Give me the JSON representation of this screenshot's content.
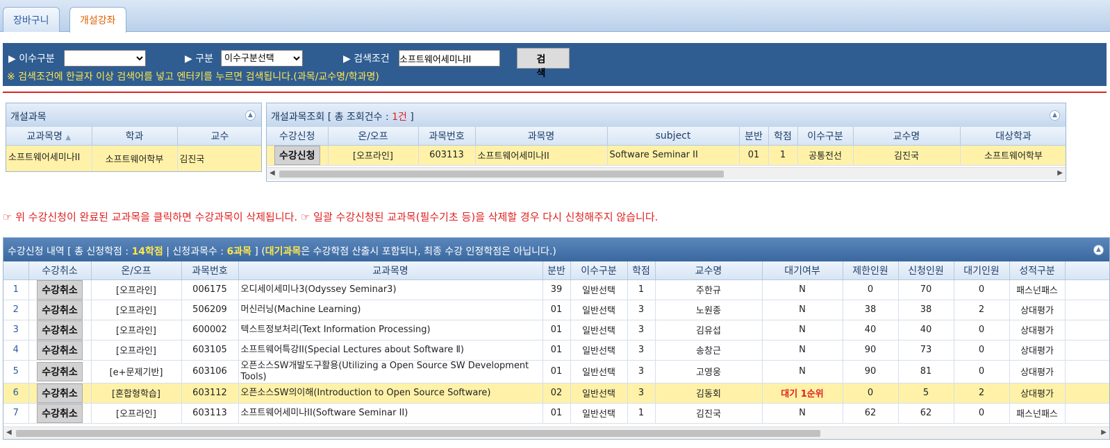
{
  "tabs": [
    {
      "label": "장바구니",
      "active": false
    },
    {
      "label": "개설강좌",
      "active": true
    }
  ],
  "search": {
    "category_label": "▶ 이수구분",
    "category_value": "",
    "type_label": "▶ 구분",
    "type_value": "이수구분선택",
    "cond_label": "▶ 검색조건",
    "cond_value": "소프트웨어세미나II",
    "button_label": "검 색",
    "notice": "※ 검색조건에 한글자 이상 검색어를 넣고 엔터키를 누르면 검색됩니다.(과목/교수명/학과명)"
  },
  "open_courses": {
    "title": "개설과목",
    "headers": [
      "교과목명",
      "학과",
      "교수"
    ],
    "rows": [
      [
        "소프트웨어세미나II",
        "소프트웨어학부",
        "김진국"
      ]
    ]
  },
  "course_search": {
    "title_prefix": "개설과목조회 [ 총 조회건수 : ",
    "count": "1건",
    "title_suffix": " ]",
    "headers": [
      "수강신청",
      "온/오프",
      "과목번호",
      "과목명",
      "subject",
      "분반",
      "학점",
      "이수구분",
      "교수명",
      "대상학과"
    ],
    "rows": [
      [
        "수강신청",
        "[오프라인]",
        "603113",
        "소프트웨어세미나II",
        "Software Seminar II",
        "01",
        "1",
        "공통전선",
        "김진국",
        "소프트웨어학부"
      ]
    ]
  },
  "warning": "☞ 위 수강신청이 완료된 교과목을 클릭하면 수강과목이 삭제됩니다. ☞ 일괄 수강신청된 교과목(필수기초 등)을 삭제할 경우 다시 신청해주지 않습니다.",
  "enrolled": {
    "t1": "수강신청 내역 [ 총 신청학점 : ",
    "credits": "14학점",
    "t2": " | 신청과목수 : ",
    "courses": "6과목",
    "t3": " ] (",
    "wait_word": "대기과목",
    "t4": "은 수강학점 산출시 포함되나, 최종 수강 인정학점은 아닙니다.)",
    "headers": [
      "",
      "수강취소",
      "온/오프",
      "과목번호",
      "교과목명",
      "분반",
      "이수구분",
      "학점",
      "교수명",
      "대기여부",
      "제한인원",
      "신청인원",
      "대기인원",
      "성적구분"
    ],
    "rows": [
      [
        "1",
        "수강취소",
        "[오프라인]",
        "006175",
        "오디세이세미나3(Odyssey Seminar3)",
        "39",
        "일반선택",
        "1",
        "주한규",
        "N",
        "0",
        "70",
        "0",
        "패스넌패스"
      ],
      [
        "2",
        "수강취소",
        "[오프라인]",
        "506209",
        "머신러닝(Machine Learning)",
        "01",
        "일반선택",
        "3",
        "노원종",
        "N",
        "38",
        "38",
        "2",
        "상대평가"
      ],
      [
        "3",
        "수강취소",
        "[오프라인]",
        "600002",
        "텍스트정보처리(Text Information Processing)",
        "01",
        "일반선택",
        "3",
        "김유섭",
        "N",
        "40",
        "40",
        "0",
        "상대평가"
      ],
      [
        "4",
        "수강취소",
        "[오프라인]",
        "603105",
        "소프트웨어특강II(Special Lectures about Software Ⅱ)",
        "01",
        "일반선택",
        "3",
        "송창근",
        "N",
        "90",
        "73",
        "0",
        "상대평가"
      ],
      [
        "5",
        "수강취소",
        "[e+문제기반]",
        "603106",
        "오픈소스SW개발도구활용(Utilizing a Open Source SW Development Tools)",
        "01",
        "일반선택",
        "3",
        "고영웅",
        "N",
        "90",
        "81",
        "0",
        "상대평가"
      ],
      [
        "6",
        "수강취소",
        "[혼합형학습]",
        "603112",
        "오픈소스SW의이해(Introduction to Open Source Software)",
        "02",
        "일반선택",
        "3",
        "김동회",
        "대기 1순위",
        "0",
        "5",
        "2",
        "상대평가"
      ],
      [
        "7",
        "수강취소",
        "[오프라인]",
        "603113",
        "소프트웨어세미나II(Software Seminar II)",
        "01",
        "일반선택",
        "1",
        "김진국",
        "N",
        "62",
        "62",
        "0",
        "패스넌패스"
      ]
    ]
  }
}
